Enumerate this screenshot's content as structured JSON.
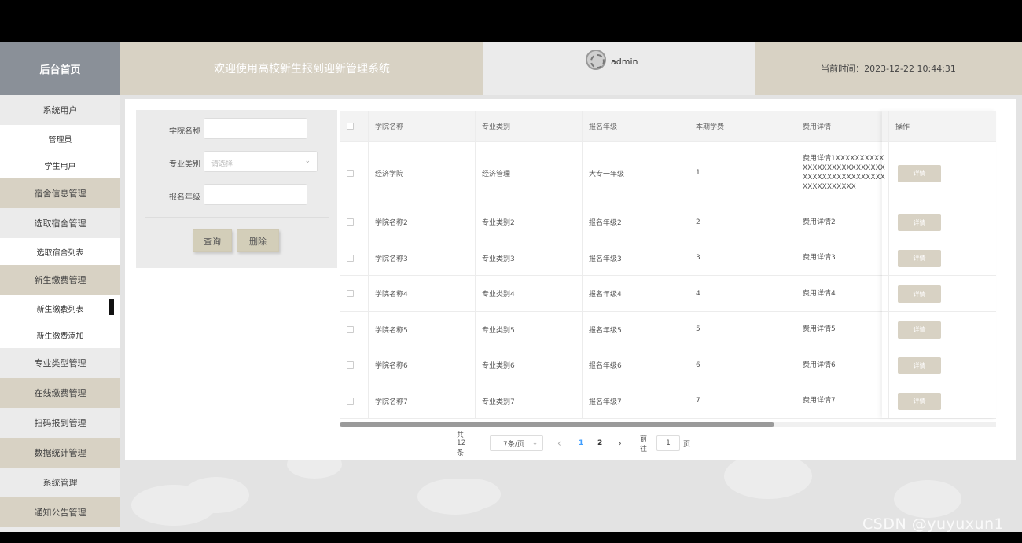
{
  "header": {
    "brand": "后台首页",
    "welcome": "欢迎使用高校新生报到迎新管理系统",
    "username": "admin",
    "time_label": "当前时间：",
    "time_value": "2023-12-22 10:44:31"
  },
  "sidebar": [
    {
      "label": "系统用户",
      "kind": "menu-light"
    },
    {
      "label": "管理员",
      "kind": "sub"
    },
    {
      "label": "学生用户",
      "kind": "sub"
    },
    {
      "label": "宿舍信息管理",
      "kind": "menu-tan"
    },
    {
      "label": "选取宿舍管理",
      "kind": "menu-light"
    },
    {
      "label": "选取宿舍列表",
      "kind": "sub"
    },
    {
      "label": "新生缴费管理",
      "kind": "menu-tan"
    },
    {
      "label": "新生缴费列表",
      "kind": "sub"
    },
    {
      "label": "新生缴费添加",
      "kind": "sub"
    },
    {
      "label": "专业类型管理",
      "kind": "menu-light"
    },
    {
      "label": "在线缴费管理",
      "kind": "menu-tan"
    },
    {
      "label": "扫码报到管理",
      "kind": "menu-light"
    },
    {
      "label": "数据统计管理",
      "kind": "menu-tan"
    },
    {
      "label": "系统管理",
      "kind": "menu-light"
    },
    {
      "label": "通知公告管理",
      "kind": "menu-tan"
    }
  ],
  "search": {
    "college_label": "学院名称",
    "college_value": "",
    "major_label": "专业类别",
    "major_placeholder": "请选择",
    "grade_label": "报名年级",
    "grade_value": "",
    "query_button": "查询",
    "delete_button": "删除"
  },
  "table": {
    "headers": [
      "学院名称",
      "专业类别",
      "报名年级",
      "本期学费",
      "费用详情",
      "操作"
    ],
    "detail_button": "详情",
    "rows": [
      {
        "college": "经济学院",
        "major": "经济管理",
        "grade": "大专一年级",
        "fee": "1",
        "detail": "费用详情1XXXXXXXXXXXXXXXXXXXXXXXXXXXXXXXXXXXXXXXXXXXXXXXXXXXXXXX"
      },
      {
        "college": "学院名称2",
        "major": "专业类别2",
        "grade": "报名年级2",
        "fee": "2",
        "detail": "费用详情2"
      },
      {
        "college": "学院名称3",
        "major": "专业类别3",
        "grade": "报名年级3",
        "fee": "3",
        "detail": "费用详情3"
      },
      {
        "college": "学院名称4",
        "major": "专业类别4",
        "grade": "报名年级4",
        "fee": "4",
        "detail": "费用详情4"
      },
      {
        "college": "学院名称5",
        "major": "专业类别5",
        "grade": "报名年级5",
        "fee": "5",
        "detail": "费用详情5"
      },
      {
        "college": "学院名称6",
        "major": "专业类别6",
        "grade": "报名年级6",
        "fee": "6",
        "detail": "费用详情6"
      },
      {
        "college": "学院名称7",
        "major": "专业类别7",
        "grade": "报名年级7",
        "fee": "7",
        "detail": "费用详情7"
      }
    ]
  },
  "pagination": {
    "total": "共 12 条",
    "page_size": "7条/页",
    "prev": "‹",
    "page1": "1",
    "page2": "2",
    "next": "›",
    "goto_label": "前往",
    "goto_value": "1",
    "page_suffix": "页"
  },
  "watermark": "CSDN @yuyuxun1",
  "colors": {
    "tan": "#d8d2c4",
    "brand": "#8a9098",
    "active_page": "#409eff"
  }
}
